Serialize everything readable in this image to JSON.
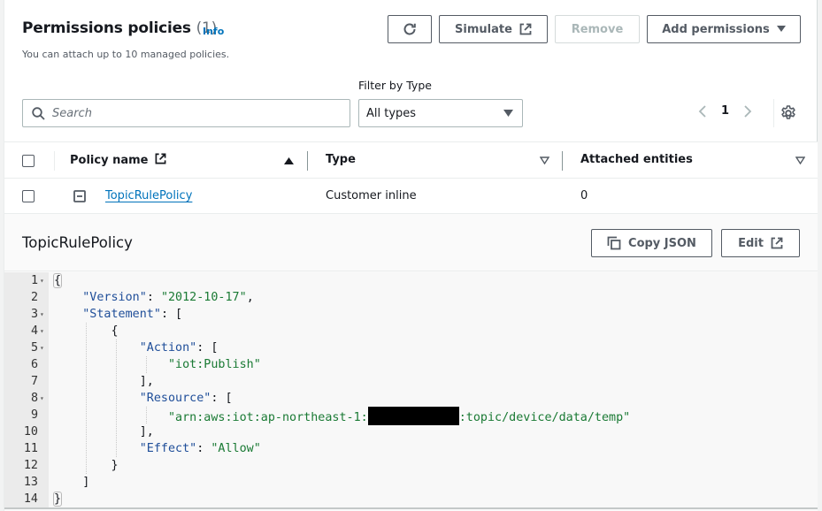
{
  "header": {
    "title": "Permissions policies",
    "count": "(1)",
    "info_link": "Info",
    "description": "You can attach up to 10 managed policies."
  },
  "toolbar": {
    "refresh_icon": "refresh-icon",
    "simulate_label": "Simulate",
    "remove_label": "Remove",
    "add_permissions_label": "Add permissions"
  },
  "filters": {
    "search_placeholder": "Search",
    "search_value": "",
    "type_label": "Filter by Type",
    "type_selected": "All types"
  },
  "pagination": {
    "current_page": "1"
  },
  "table": {
    "columns": [
      {
        "label": "Policy name",
        "sort": "ascending"
      },
      {
        "label": "Type",
        "sort": "none"
      },
      {
        "label": "Attached entities",
        "sort": "none"
      }
    ],
    "rows": [
      {
        "policy_name": "TopicRulePolicy",
        "type": "Customer inline",
        "attached_entities": "0",
        "expanded": true,
        "selected": false
      }
    ]
  },
  "detail": {
    "title": "TopicRulePolicy",
    "copy_json_label": "Copy JSON",
    "edit_label": "Edit",
    "code_lines": [
      {
        "n": "1",
        "fold": true
      },
      {
        "n": "2",
        "fold": false
      },
      {
        "n": "3",
        "fold": true
      },
      {
        "n": "4",
        "fold": true
      },
      {
        "n": "5",
        "fold": true
      },
      {
        "n": "6",
        "fold": false
      },
      {
        "n": "7",
        "fold": false
      },
      {
        "n": "8",
        "fold": true
      },
      {
        "n": "9",
        "fold": false
      },
      {
        "n": "10",
        "fold": false
      },
      {
        "n": "11",
        "fold": false
      },
      {
        "n": "12",
        "fold": false
      },
      {
        "n": "13",
        "fold": false
      },
      {
        "n": "14",
        "fold": false
      }
    ],
    "policy": {
      "version_key": "\"Version\"",
      "version_value": "\"2012-10-17\"",
      "statement_key": "\"Statement\"",
      "action_key": "\"Action\"",
      "action_value": "\"iot:Publish\"",
      "resource_key": "\"Resource\"",
      "resource_prefix": "\"arn:aws:iot:ap-northeast-1:",
      "resource_suffix": ":topic/device/data/temp\"",
      "effect_key": "\"Effect\"",
      "effect_value": "\"Allow\""
    }
  }
}
